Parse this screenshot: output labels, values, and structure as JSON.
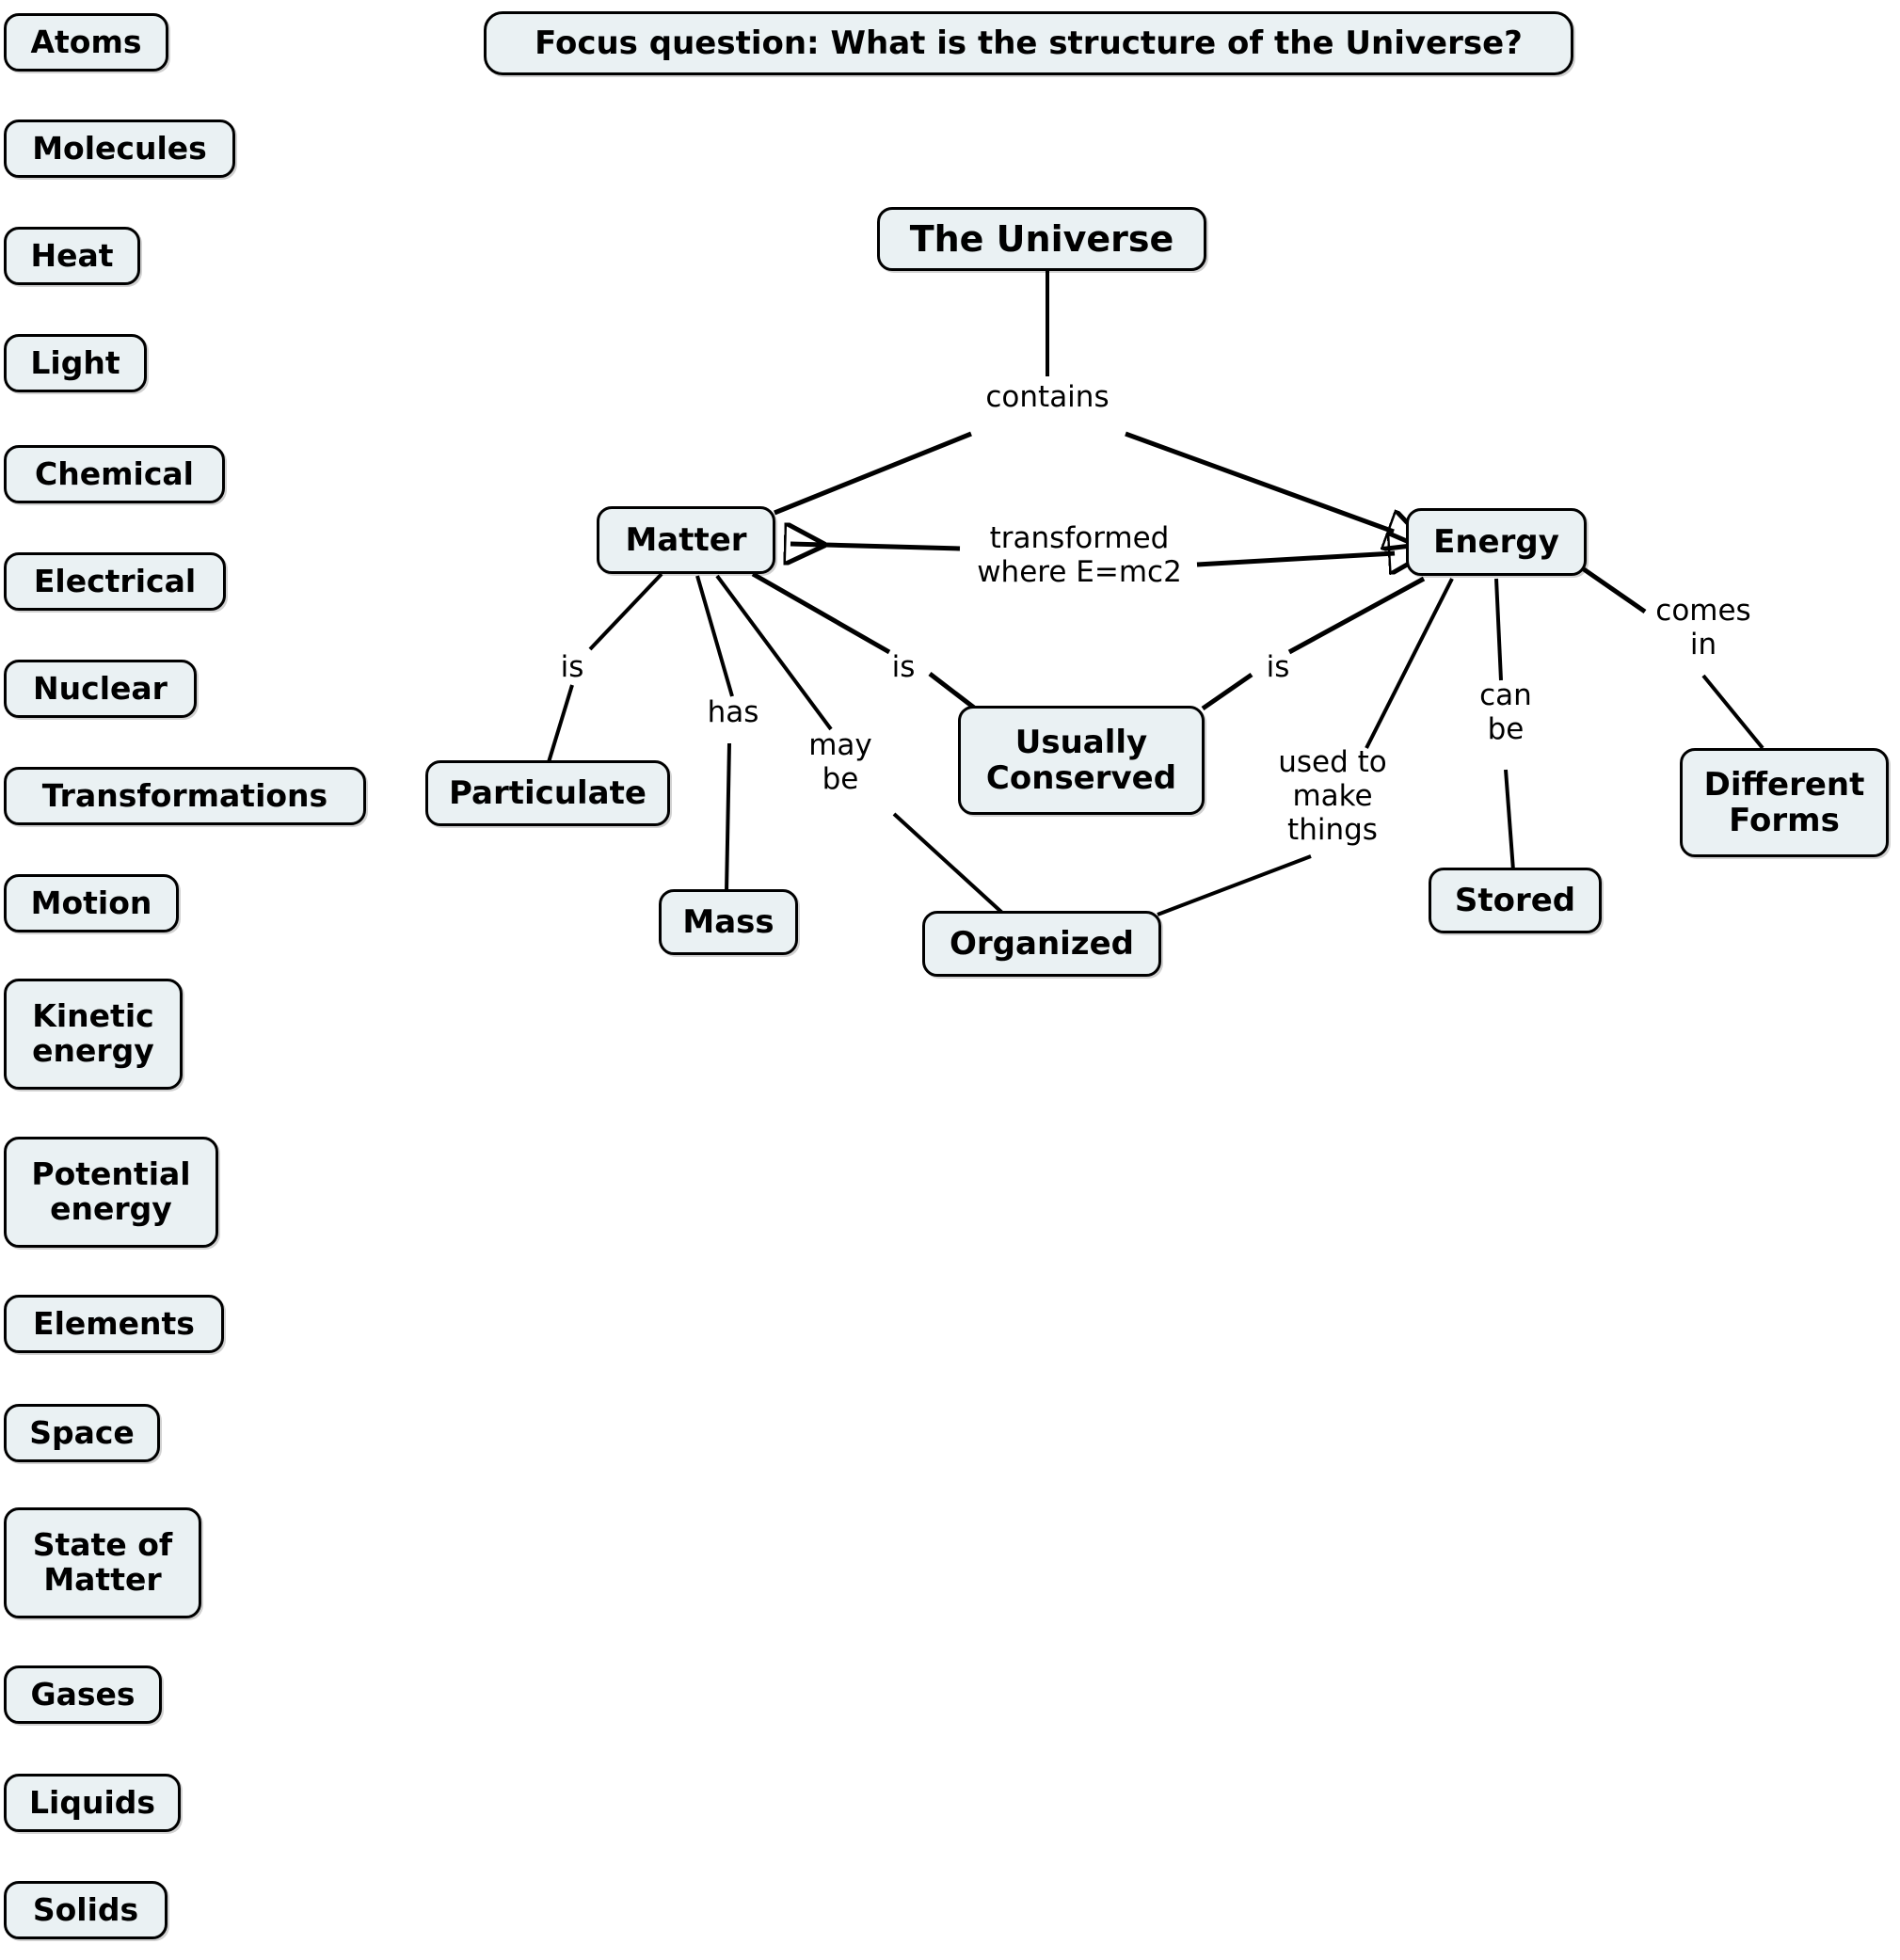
{
  "document": {
    "type": "concept-map",
    "title": "Focus question: What is the structure of the Universe?",
    "background_color": "#ffffff",
    "node_fill_color": "#eaf1f3",
    "node_border_color": "#000000",
    "text_color": "#000000"
  },
  "focus": {
    "label": "Focus question: What is the structure of the Universe?"
  },
  "parking_lot": {
    "items": [
      {
        "label": "Atoms"
      },
      {
        "label": "Molecules"
      },
      {
        "label": "Heat"
      },
      {
        "label": "Light"
      },
      {
        "label": "Chemical"
      },
      {
        "label": "Electrical"
      },
      {
        "label": "Nuclear"
      },
      {
        "label": "Transformations"
      },
      {
        "label": "Motion"
      },
      {
        "label": "Kinetic\nenergy"
      },
      {
        "label": "Potential\nenergy"
      },
      {
        "label": "Elements"
      },
      {
        "label": "Space"
      },
      {
        "label": "State of\nMatter"
      },
      {
        "label": "Gases"
      },
      {
        "label": "Liquids"
      },
      {
        "label": "Solids"
      }
    ]
  },
  "map": {
    "nodes": [
      {
        "id": "universe",
        "label": "The Universe"
      },
      {
        "id": "matter",
        "label": "Matter"
      },
      {
        "id": "energy",
        "label": "Energy"
      },
      {
        "id": "particulate",
        "label": "Particulate"
      },
      {
        "id": "mass",
        "label": "Mass"
      },
      {
        "id": "conserved",
        "label": "Usually\nConserved"
      },
      {
        "id": "organized",
        "label": "Organized"
      },
      {
        "id": "stored",
        "label": "Stored"
      },
      {
        "id": "forms",
        "label": "Different\nForms"
      }
    ],
    "links": [
      {
        "id": "l1",
        "from": "universe",
        "to": "matter",
        "label": "contains",
        "arrow": false
      },
      {
        "id": "l2",
        "from": "universe",
        "to": "energy",
        "label": "contains",
        "arrow": true
      },
      {
        "id": "l3",
        "from": "matter",
        "to": "energy",
        "label": "transformed\nwhere E=mc2",
        "arrow": "both"
      },
      {
        "id": "l4",
        "from": "matter",
        "to": "particulate",
        "label": "is",
        "arrow": false
      },
      {
        "id": "l5",
        "from": "matter",
        "to": "mass",
        "label": "has",
        "arrow": false
      },
      {
        "id": "l6",
        "from": "matter",
        "to": "organized",
        "label": "may\nbe",
        "arrow": false
      },
      {
        "id": "l7",
        "from": "matter",
        "to": "conserved",
        "label": "is",
        "arrow": false
      },
      {
        "id": "l8",
        "from": "energy",
        "to": "conserved",
        "label": "is",
        "arrow": false
      },
      {
        "id": "l9",
        "from": "energy",
        "to": "organized",
        "label": "used to\nmake\nthings",
        "arrow": false
      },
      {
        "id": "l10",
        "from": "energy",
        "to": "stored",
        "label": "can\nbe",
        "arrow": false
      },
      {
        "id": "l11",
        "from": "energy",
        "to": "forms",
        "label": "comes\nin",
        "arrow": false
      }
    ]
  },
  "labels": {
    "contains": "contains",
    "transformed": "transformed\nwhere E=mc2",
    "is_particulate": "is",
    "has_mass": "has",
    "may_be": "may\nbe",
    "is_conserved_matter": "is",
    "is_conserved_energy": "is",
    "used_to_make_things": "used to\nmake\nthings",
    "can_be": "can\nbe",
    "comes_in": "comes\nin"
  }
}
